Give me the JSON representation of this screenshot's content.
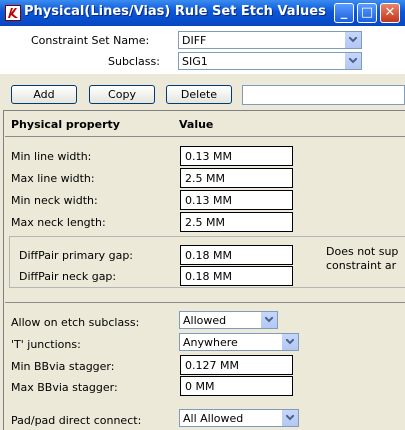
{
  "window": {
    "title": "Physical(Lines/Vias) Rule Set Etch Values",
    "minimize_label": "_",
    "maximize_label": "□",
    "close_label": "✕"
  },
  "header": {
    "constraint_set_label": "Constraint Set Name:",
    "constraint_set_value": "DIFF",
    "subclass_label": "Subclass:",
    "subclass_value": "SIG1"
  },
  "toolbar": {
    "add_label": "Add",
    "copy_label": "Copy",
    "delete_label": "Delete",
    "name_field_value": ""
  },
  "table": {
    "col_property": "Physical property",
    "col_value": "Value"
  },
  "lines": {
    "min_line_width_label": "Min line width:",
    "min_line_width_value": "0.13 MM",
    "max_line_width_label": "Max line width:",
    "max_line_width_value": "2.5 MM",
    "min_neck_width_label": "Min neck width:",
    "min_neck_width_value": "0.13 MM",
    "max_neck_length_label": "Max neck length:",
    "max_neck_length_value": "2.5 MM"
  },
  "diffpair": {
    "primary_gap_label": "DiffPair primary gap:",
    "primary_gap_value": "0.18 MM",
    "neck_gap_label": "DiffPair neck gap:",
    "neck_gap_value": "0.18 MM",
    "note_line1": "Does not sup",
    "note_line2": "constraint ar"
  },
  "etch": {
    "allow_subclass_label": "Allow on etch subclass:",
    "allow_subclass_value": "Allowed",
    "t_junctions_label": "'T' junctions:",
    "t_junctions_value": "Anywhere",
    "min_bbvia_label": "Min BBvia stagger:",
    "min_bbvia_value": "0.127 MM",
    "max_bbvia_label": "Max BBvia stagger:",
    "max_bbvia_value": "0 MM",
    "pad_connect_label": "Pad/pad direct connect:",
    "pad_connect_value": "All Allowed"
  },
  "colors": {
    "titlebar": "#0a56d8",
    "window_bg": "#ece9d8",
    "field_border": "#7f9db9"
  }
}
